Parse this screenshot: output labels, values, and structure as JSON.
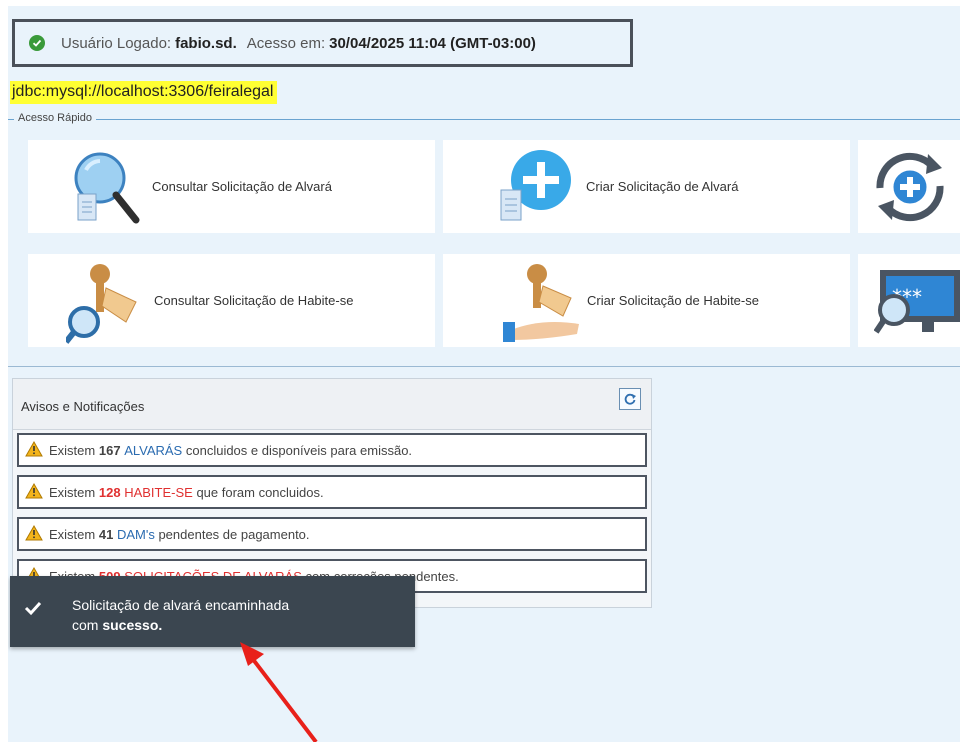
{
  "header": {
    "logged_label": "Usuário Logado:",
    "user": "fabio.sd.",
    "access_label": "Acesso em:",
    "access_datetime": "30/04/2025 11:04 (GMT-03:00)",
    "jdbc_url": "jdbc:mysql://localhost:3306/feiralegal"
  },
  "quick_access": {
    "legend": "Acesso Rápido",
    "tiles": [
      {
        "label": "Consultar Solicitação de Alvará",
        "icon": "search-document-icon"
      },
      {
        "label": "Criar Solicitação de Alvará",
        "icon": "add-document-icon"
      },
      {
        "label": "",
        "icon": "sync-add-icon"
      },
      {
        "label": "Consultar Solicitação de Habite-se",
        "icon": "search-keys-icon"
      },
      {
        "label": "Criar Solicitação de Habite-se",
        "icon": "hand-keys-icon"
      },
      {
        "label": "",
        "icon": "password-screen-icon"
      }
    ]
  },
  "notifications": {
    "title": "Avisos e Notificações",
    "items": [
      {
        "prefix": "Existem",
        "count": "167",
        "entity": "ALVARÁS",
        "suffix": "concluidos e disponíveis para emissão."
      },
      {
        "prefix": "Existem",
        "count": "128",
        "entity": "HABITE-SE",
        "suffix": "que foram concluidos."
      },
      {
        "prefix": "Existem",
        "count": "41",
        "entity": "DAM's",
        "suffix": "pendentes de pagamento."
      },
      {
        "prefix": "Existem",
        "count": "509",
        "entity": "SOLICITAÇÕES DE ALVARÁS",
        "suffix": "com correções pendentes."
      }
    ]
  },
  "toast": {
    "line1": "Solicitação de alvará encaminhada",
    "line2_prefix": "com",
    "line2_bold": "sucesso."
  },
  "colors": {
    "accent_blue": "#2a6bb0",
    "alert_red": "#e03030",
    "toast_bg": "#3b4650",
    "highlight": "#ffff33"
  }
}
